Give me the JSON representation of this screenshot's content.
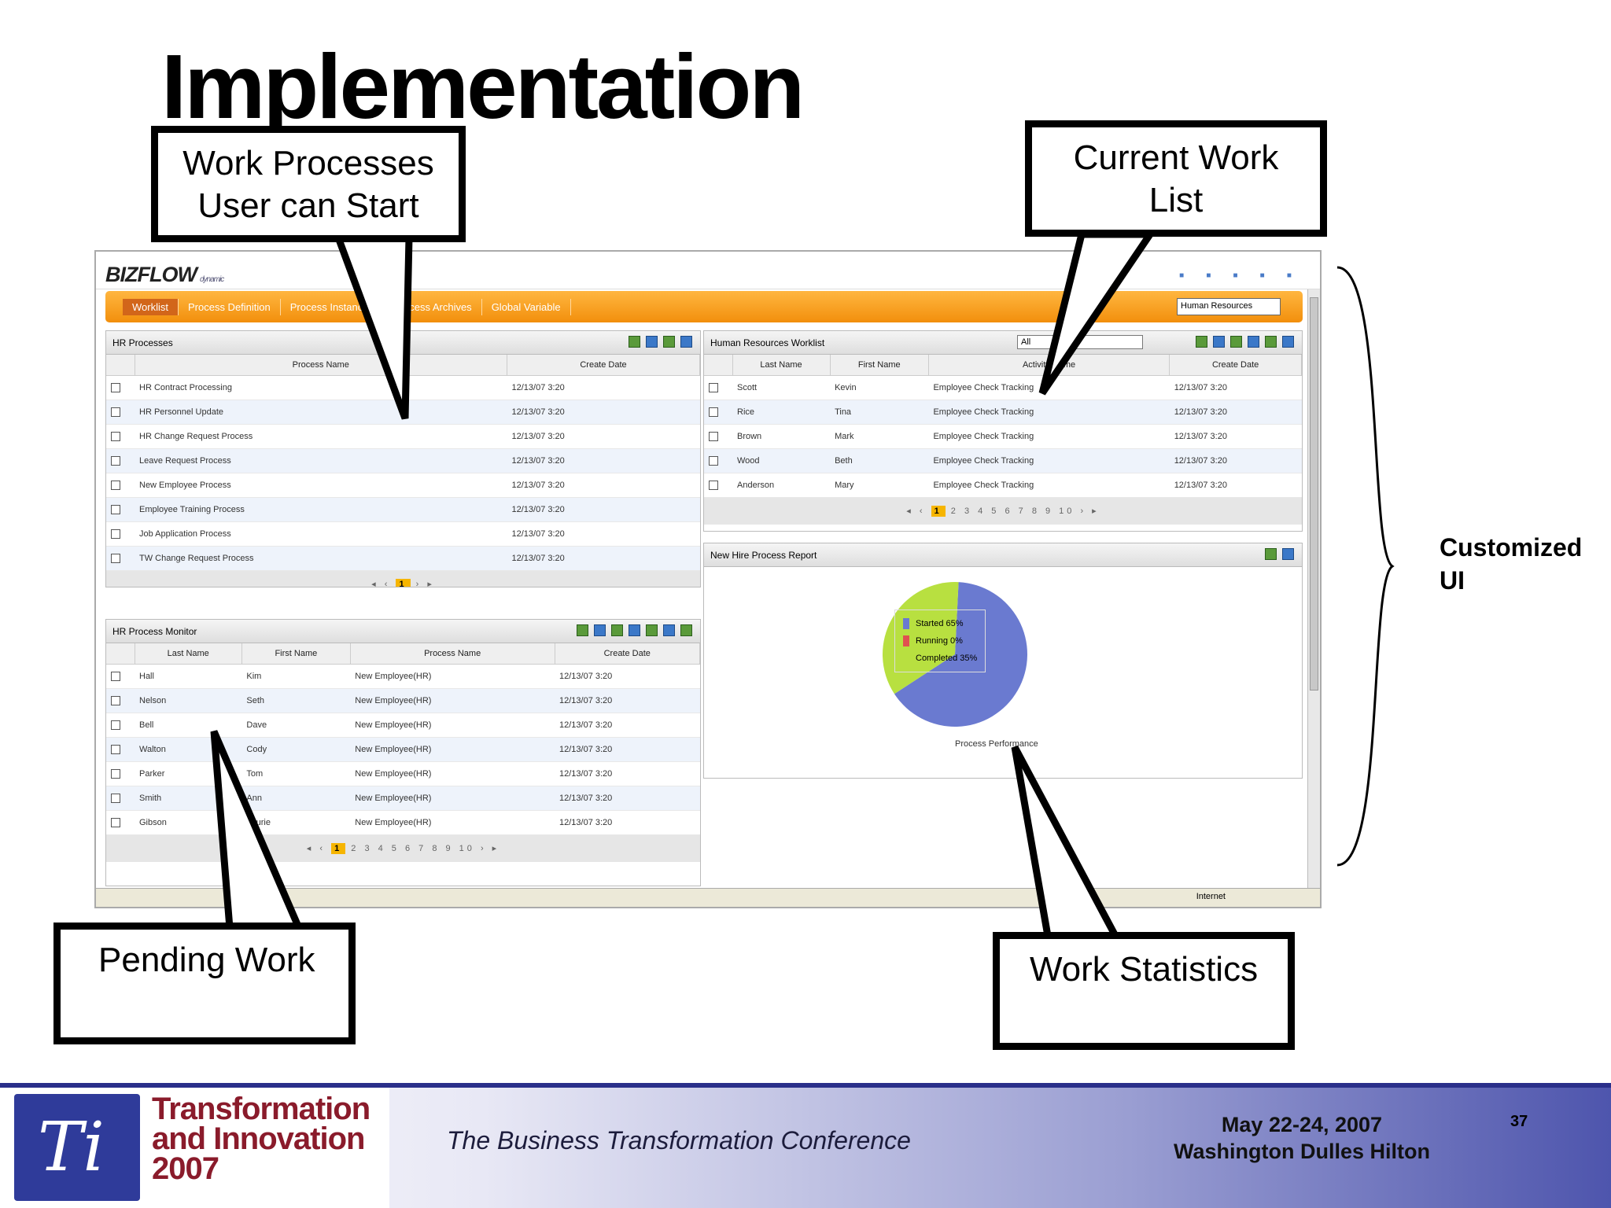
{
  "slide": {
    "title": "Implementation",
    "side_label": "Customized\nUI"
  },
  "callouts": {
    "start": "Work Processes\nUser can Start",
    "current": "Current Work\nList",
    "pending": "Pending Work",
    "stats": "Work Statistics"
  },
  "app": {
    "logo": "BIZFLOW",
    "logo_sub": "dynamic",
    "nav_tabs": [
      {
        "label": "Worklist"
      },
      {
        "label": "Process Definition"
      },
      {
        "label": "Process Instances"
      },
      {
        "label": "Process Archives"
      },
      {
        "label": "Global Variable"
      }
    ],
    "nav_select": "Human Resources",
    "start_panel": {
      "title": "HR Processes",
      "headers": [
        "Process Name",
        "Create Date"
      ],
      "rows": [
        [
          "HR Contract Processing",
          "12/13/07 3:20"
        ],
        [
          "HR Personnel Update",
          "12/13/07 3:20"
        ],
        [
          "HR Change Request Process",
          "12/13/07 3:20"
        ],
        [
          "Leave Request Process",
          "12/13/07 3:20"
        ],
        [
          "New Employee Process",
          "12/13/07 3:20"
        ],
        [
          "Employee Training Process",
          "12/13/07 3:20"
        ],
        [
          "Job Application Process",
          "12/13/07 3:20"
        ],
        [
          "TW Change Request Process",
          "12/13/07 3:20"
        ]
      ]
    },
    "monitor_panel": {
      "title": "HR Process Monitor",
      "headers": [
        "Last Name",
        "First Name",
        "Process Name",
        "Create Date"
      ],
      "rows": [
        [
          "Hall",
          "Kim",
          "New Employee(HR)",
          "12/13/07 3:20"
        ],
        [
          "Nelson",
          "Seth",
          "New Employee(HR)",
          "12/13/07 3:20"
        ],
        [
          "Bell",
          "Dave",
          "New Employee(HR)",
          "12/13/07 3:20"
        ],
        [
          "Walton",
          "Cody",
          "New Employee(HR)",
          "12/13/07 3:20"
        ],
        [
          "Parker",
          "Tom",
          "New Employee(HR)",
          "12/13/07 3:20"
        ],
        [
          "Smith",
          "Ann",
          "New Employee(HR)",
          "12/13/07 3:20"
        ],
        [
          "Gibson",
          "Laurie",
          "New Employee(HR)",
          "12/13/07 3:20"
        ]
      ]
    },
    "worklist_panel": {
      "title": "Human Resources Worklist",
      "filter_value": "All",
      "headers": [
        "Last Name",
        "First Name",
        "Activity Name",
        "Create Date"
      ],
      "rows": [
        [
          "Scott",
          "Kevin",
          "Employee Check Tracking",
          "12/13/07 3:20"
        ],
        [
          "Rice",
          "Tina",
          "Employee Check Tracking",
          "12/13/07 3:20"
        ],
        [
          "Brown",
          "Mark",
          "Employee Check Tracking",
          "12/13/07 3:20"
        ],
        [
          "Wood",
          "Beth",
          "Employee Check Tracking",
          "12/13/07 3:20"
        ],
        [
          "Anderson",
          "Mary",
          "Employee Check Tracking",
          "12/13/07 3:20"
        ]
      ]
    },
    "report_panel": {
      "title": "New Hire Process Report",
      "caption": "Process Performance"
    },
    "status_zone": "Internet"
  },
  "chart_data": {
    "type": "pie",
    "slices": [
      {
        "label": "Started",
        "value": 65,
        "color": "#6a7ad0"
      },
      {
        "label": "Running",
        "value": 0,
        "color": "#e05050"
      },
      {
        "label": "Completed",
        "value": 35,
        "color": "#b8e040"
      }
    ]
  },
  "footer": {
    "brand": "Transformation\nand Innovation\n2007",
    "emblem": "Ti",
    "conference": "The Business Transformation Conference",
    "date_place": "May 22-24, 2007\nWashington Dulles Hilton",
    "page": "37"
  }
}
